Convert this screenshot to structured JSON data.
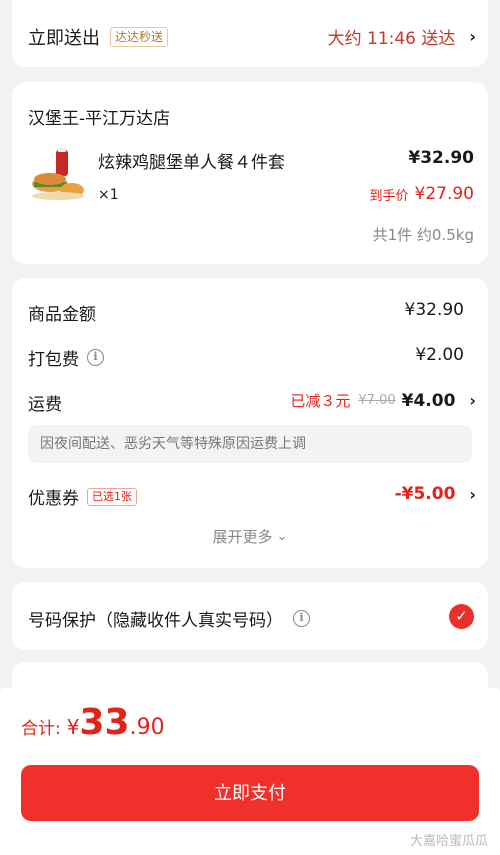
{
  "delivery": {
    "title": "立即送出",
    "tag": "达达秒送",
    "eta": "大约 11:46 送达"
  },
  "order": {
    "store_name": "汉堡王-平江万达店",
    "item_name": "炫辣鸡腿堡单人餐４件套",
    "quantity": "×1",
    "price": "¥32.90",
    "final_price_label": "到手价",
    "final_price": "¥27.90",
    "summary": "共1件 约0.5kg"
  },
  "fees": {
    "goods_label": "商品金额",
    "goods_value": "¥32.90",
    "packing_label": "打包费",
    "packing_value": "¥2.00",
    "shipping_label": "运费",
    "shipping_discount": "已减３元",
    "shipping_original": "¥7.00",
    "shipping_value": "¥4.00",
    "notice": "因夜间配送、恶劣天气等特殊原因运费上调",
    "coupon_label": "优惠券",
    "coupon_tag": "已选1张",
    "coupon_value": "-¥5.00",
    "expand": "展开更多"
  },
  "privacy": {
    "label": "号码保护（隐藏收件人真实号码）"
  },
  "checkout": {
    "total_label": "合计:",
    "currency": "¥",
    "total_integer": "33",
    "total_decimal": ".90",
    "pay_button": "立即支付"
  },
  "watermark": "大嘉哈蜜瓜瓜",
  "colors": {
    "accent_red": "#e9302a",
    "tag_gold": "#b07a30"
  }
}
